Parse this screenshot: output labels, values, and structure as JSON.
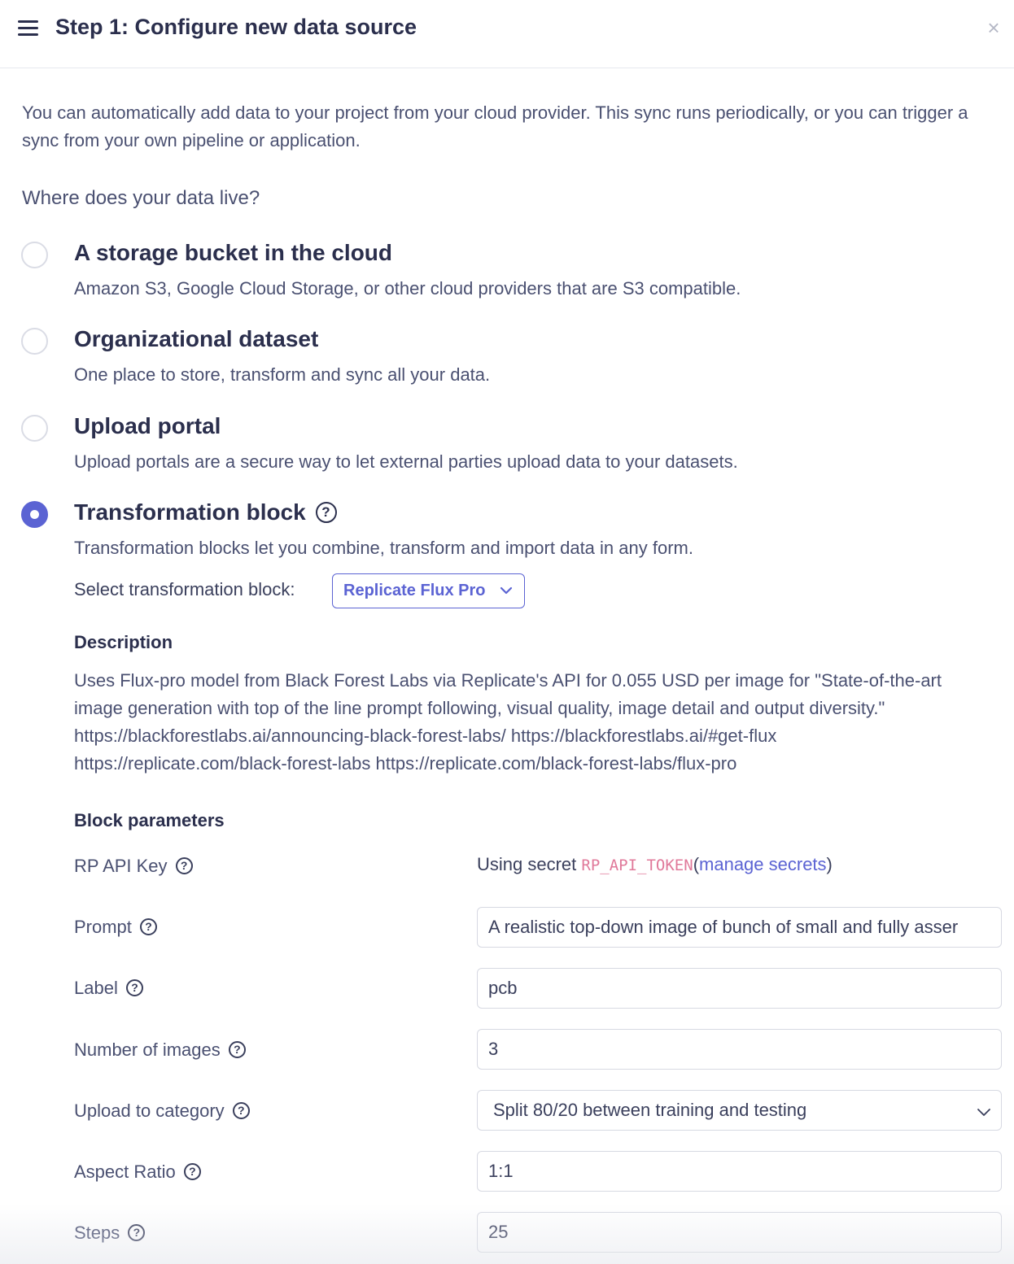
{
  "header": {
    "title": "Step 1: Configure new data source",
    "close_glyph": "×"
  },
  "intro": "You can automatically add data to your project from your cloud provider. This sync runs periodically, or you can trigger a sync from your own pipeline or application.",
  "question": "Where does your data live?",
  "options": [
    {
      "title": "A storage bucket in the cloud",
      "description": "Amazon S3, Google Cloud Storage, or other cloud providers that are S3 compatible.",
      "selected": false
    },
    {
      "title": "Organizational dataset",
      "description": "One place to store, transform and sync all your data.",
      "selected": false
    },
    {
      "title": "Upload portal",
      "description": "Upload portals are a secure way to let external parties upload data to your datasets.",
      "selected": false
    },
    {
      "title": "Transformation block",
      "description": "Transformation blocks let you combine, transform and import data in any form.",
      "selected": true
    }
  ],
  "transformation": {
    "select_label": "Select transformation block:",
    "selected_block": "Replicate Flux Pro",
    "description_heading": "Description",
    "description": "Uses Flux-pro model from Black Forest Labs via Replicate's API for 0.055 USD per image for \"State-of-the-art image generation with top of the line prompt following, visual quality, image detail and output diversity.\" https://blackforestlabs.ai/announcing-black-forest-labs/ https://blackforestlabs.ai/#get-flux https://replicate.com/black-forest-labs https://replicate.com/black-forest-labs/flux-pro"
  },
  "parameters": {
    "heading": "Block parameters",
    "api_key": {
      "label": "RP API Key",
      "prefix": "Using secret",
      "secret_name": "RP_API_TOKEN",
      "open_paren": "(",
      "link": "manage secrets",
      "close_paren": ")"
    },
    "prompt": {
      "label": "Prompt",
      "value": "A realistic top-down image of bunch of small and fully asser"
    },
    "label": {
      "label": "Label",
      "value": "pcb"
    },
    "num_images": {
      "label": "Number of images",
      "value": "3"
    },
    "category": {
      "label": "Upload to category",
      "value": "Split 80/20 between training and testing"
    },
    "aspect_ratio": {
      "label": "Aspect Ratio",
      "value": "1:1"
    },
    "steps": {
      "label": "Steps",
      "value": "25"
    }
  },
  "help_glyph": "?",
  "accent_color": "#5b63d3",
  "secret_color": "#e0799a"
}
